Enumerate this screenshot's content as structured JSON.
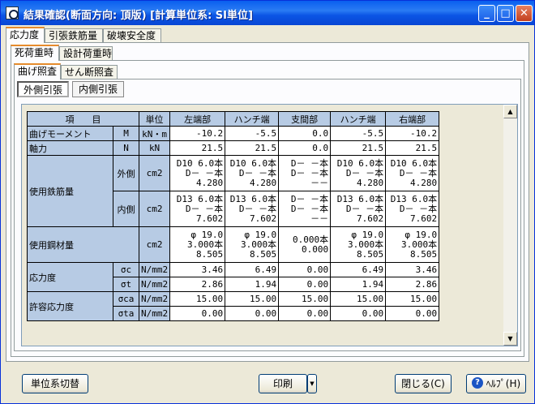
{
  "window": {
    "title": "結果確認(断面方向: 頂版)  [計算単位系: SI単位]"
  },
  "tabs_top": [
    "応力度",
    "引張鉄筋量",
    "破壊安全度"
  ],
  "tabs_load": [
    "死荷重時",
    "設計荷重時"
  ],
  "tabs_check": [
    "曲げ照査",
    "せん断照査"
  ],
  "toggles": [
    "外側引張",
    "内側引張"
  ],
  "table": {
    "headers": [
      "項　　目",
      "単位",
      "左端部",
      "ハンチ端",
      "支間部",
      "ハンチ端",
      "右端部"
    ],
    "rows": {
      "moment": {
        "label": "曲げモーメント",
        "sym": "M",
        "unit": "kN・m",
        "vals": [
          "-10.2",
          "-5.5",
          "0.0",
          "-5.5",
          "-10.2"
        ]
      },
      "axial": {
        "label": "軸力",
        "sym": "N",
        "unit": "kN",
        "vals": [
          "21.5",
          "21.5",
          "0.0",
          "21.5",
          "21.5"
        ]
      },
      "rebar_label": "使用鉄筋量",
      "rebar_outer": {
        "sub": "外側",
        "unit": "cm2",
        "vals": [
          "D10 6.0本\nD－ －本\n4.280",
          "D10 6.0本\nD－ －本\n4.280",
          "D－ －本\nD－ －本\n－－",
          "D10 6.0本\nD－ －本\n4.280",
          "D10 6.0本\nD－ －本\n4.280"
        ]
      },
      "rebar_inner": {
        "sub": "内側",
        "unit": "cm2",
        "vals": [
          "D13 6.0本\nD－ －本\n7.602",
          "D13 6.0本\nD－ －本\n7.602",
          "D－ －本\nD－ －本\n－－",
          "D13 6.0本\nD－ －本\n7.602",
          "D13 6.0本\nD－ －本\n7.602"
        ]
      },
      "steel": {
        "label": "使用鋼材量",
        "unit": "cm2",
        "vals": [
          "φ 19.0\n3.000本\n8.505",
          "φ 19.0\n3.000本\n8.505",
          "0.000本\n0.000",
          "φ 19.0\n3.000本\n8.505",
          "φ 19.0\n3.000本\n8.505"
        ]
      },
      "stress_label": "応力度",
      "sigma_c": {
        "sym": "σc",
        "unit": "N/mm2",
        "vals": [
          "3.46",
          "6.49",
          "0.00",
          "6.49",
          "3.46"
        ]
      },
      "sigma_t": {
        "sym": "σt",
        "unit": "N/mm2",
        "vals": [
          "2.86",
          "1.94",
          "0.00",
          "1.94",
          "2.86"
        ]
      },
      "allow_label": "許容応力度",
      "sigma_ca": {
        "sym": "σca",
        "unit": "N/mm2",
        "vals": [
          "15.00",
          "15.00",
          "15.00",
          "15.00",
          "15.00"
        ]
      },
      "sigma_ta": {
        "sym": "σta",
        "unit": "N/mm2",
        "vals": [
          "0.00",
          "0.00",
          "0.00",
          "0.00",
          "0.00"
        ]
      }
    }
  },
  "footer": {
    "unit_switch": "単位系切替",
    "print": "印刷",
    "close": "閉じる(C)",
    "help": "ﾍﾙﾌﾟ(H)"
  }
}
